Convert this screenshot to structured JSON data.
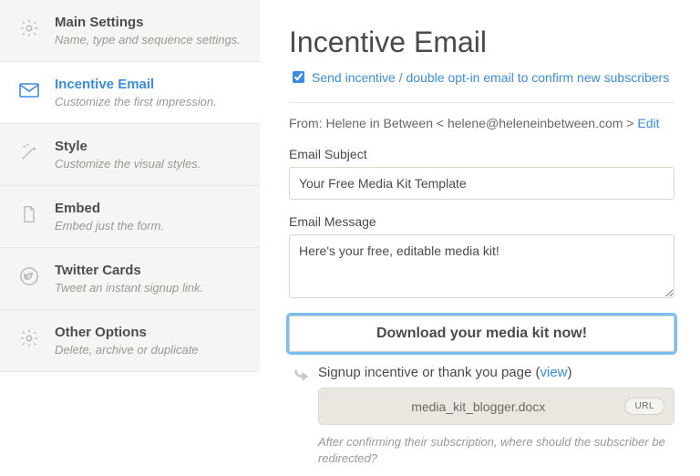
{
  "sidebar": {
    "items": [
      {
        "title": "Main Settings",
        "sub": "Name, type and sequence settings."
      },
      {
        "title": "Incentive Email",
        "sub": "Customize the first impression."
      },
      {
        "title": "Style",
        "sub": "Customize the visual styles."
      },
      {
        "title": "Embed",
        "sub": "Embed just the form."
      },
      {
        "title": "Twitter Cards",
        "sub": "Tweet an instant signup link."
      },
      {
        "title": "Other Options",
        "sub": "Delete, archive or duplicate"
      }
    ]
  },
  "page_title": "Incentive Email",
  "optin": {
    "checked": true,
    "label": "Send incentive / double opt-in email to confirm new subscribers"
  },
  "from": {
    "prefix": "From: ",
    "name": "Helene in Between",
    "email": "helene@heleneinbetween.com",
    "edit_label": "Edit"
  },
  "subject": {
    "label": "Email Subject",
    "value": "Your Free Media Kit Template"
  },
  "message": {
    "label": "Email Message",
    "value": "Here's your free, editable media kit!"
  },
  "download_label": "Download your media kit now!",
  "signup": {
    "title": "Signup incentive or thank you page (",
    "view_label": "view",
    "title_close": ")",
    "file_name": "media_kit_blogger.docx",
    "url_button": "URL",
    "helper": "After confirming their subscription, where should the subscriber be redirected?"
  }
}
